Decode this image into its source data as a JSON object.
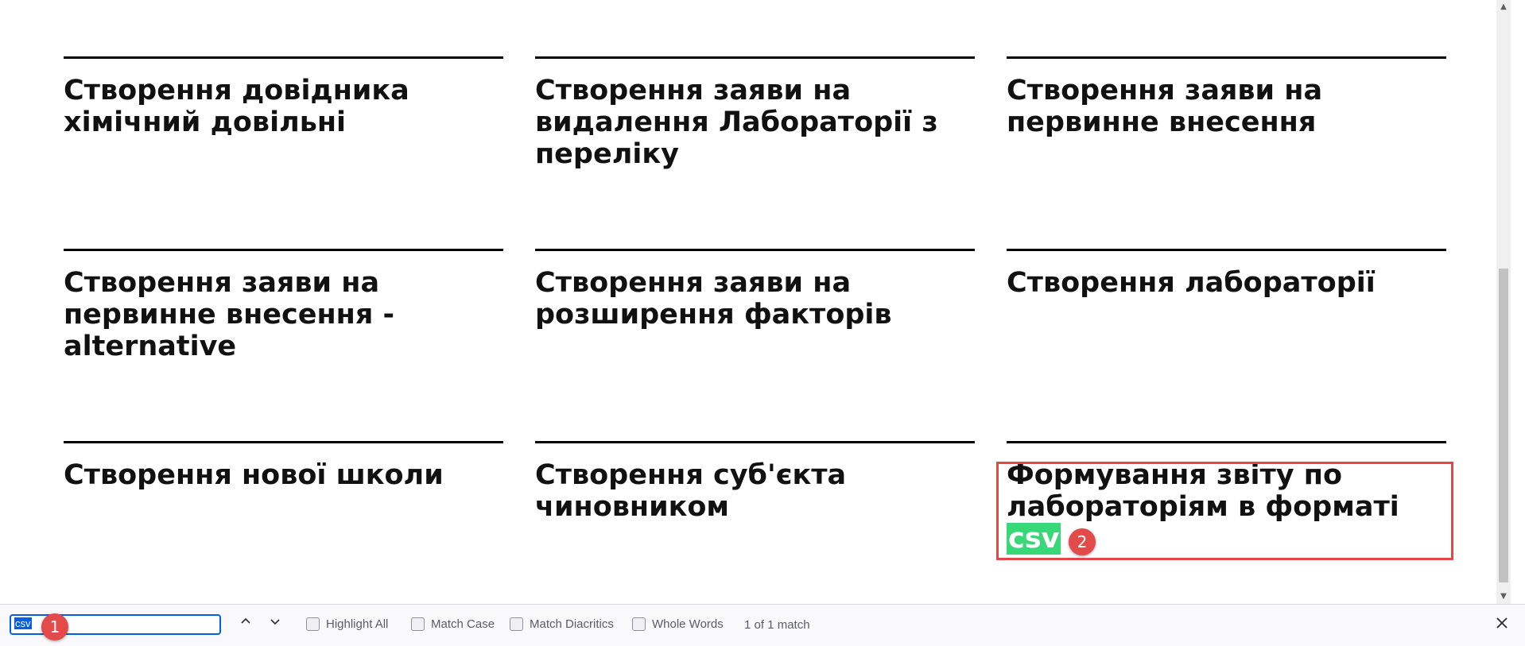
{
  "cards": [
    {
      "title": "Створення довідника хімічний довільні"
    },
    {
      "title": "Створення заяви на видалення Лабораторії з переліку"
    },
    {
      "title": "Створення заяви на первинне внесення"
    },
    {
      "title": "Створення заяви на первинне внесення - alternative"
    },
    {
      "title": "Створення заяви на розширення факторів"
    },
    {
      "title": "Створення лабораторії"
    },
    {
      "title": "Створення нової школи"
    },
    {
      "title": "Створення суб'єкта чиновником"
    },
    {
      "title_prefix": "Формування звіту по лабораторіям в форматі",
      "title_highlight": "csv"
    }
  ],
  "annotations": {
    "badge1": "1",
    "badge2": "2"
  },
  "findbar": {
    "query": "csv",
    "prev_icon": "chevron-up-icon",
    "next_icon": "chevron-down-icon",
    "highlight_all": "Highlight All",
    "match_case": "Match Case",
    "match_diacritics": "Match Diacritics",
    "whole_words": "Whole Words",
    "match_count": "1 of 1 match",
    "close_icon": "close-icon"
  },
  "colors": {
    "highlight": "#38d878",
    "annotation": "#e14848",
    "focus": "#0061e0"
  }
}
